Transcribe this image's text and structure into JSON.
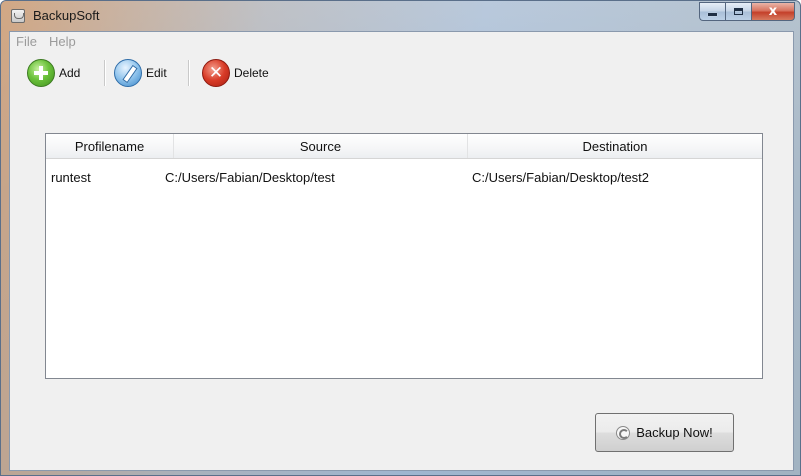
{
  "window": {
    "title": "BackupSoft",
    "caption": {
      "close_glyph": "x"
    }
  },
  "menubar": {
    "items": [
      {
        "label": "File"
      },
      {
        "label": "Help"
      }
    ]
  },
  "toolbar": {
    "add_label": "Add",
    "edit_label": "Edit",
    "delete_label": "Delete",
    "delete_glyph": "✕"
  },
  "table": {
    "columns": [
      "Profilename",
      "Source",
      "Destination"
    ],
    "rows": [
      [
        "runtest",
        "C:/Users/Fabian/Desktop/test",
        "C:/Users/Fabian/Desktop/test2"
      ]
    ]
  },
  "actions": {
    "backup_label": "Backup Now!"
  },
  "colors": {
    "add_icon": "#6cc23c",
    "edit_icon": "#3a86c8",
    "delete_icon": "#d83b27",
    "menu_text_disabled": "#9b9b9b"
  },
  "icons": {
    "app": "app-icon",
    "add": "add-icon",
    "edit": "edit-icon",
    "delete": "delete-icon",
    "backup": "refresh-icon"
  }
}
